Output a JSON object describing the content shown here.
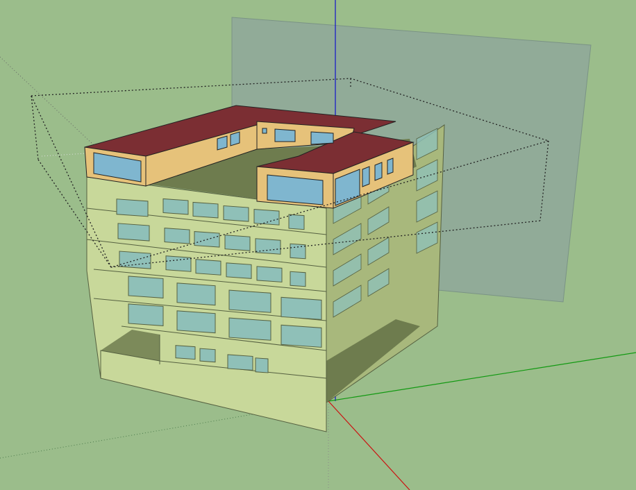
{
  "colors": {
    "ground": "#9bbd8b",
    "wall": "#c8d89a",
    "wall_dark": "#a8b87c",
    "wall_shadow": "#7c8a5a",
    "roof": "#7b2e33",
    "roof_wall": "#e6c27a",
    "glass": "#8fc0b8",
    "glass_blue": "#7fb6cf",
    "section_plane": "#8fa89a",
    "axis_red": "#cc1111",
    "axis_green": "#119911",
    "axis_blue": "#1111cc"
  },
  "scene": {
    "description_icon": "sketchup-3d-model"
  }
}
